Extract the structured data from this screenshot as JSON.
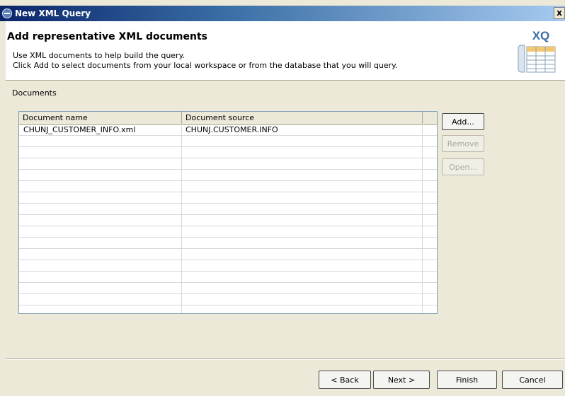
{
  "window": {
    "title": "New XML Query",
    "close_label": "x"
  },
  "header": {
    "title": "Add representative XML documents",
    "line1": "Use XML documents to help build the query.",
    "line2": "Click Add to select documents from your local workspace or from the database that you will query.",
    "badge": "XQ"
  },
  "section": {
    "label": "Documents"
  },
  "table": {
    "columns": [
      "Document name",
      "Document source"
    ],
    "rows": [
      [
        "CHUNJ_CUSTOMER_INFO.xml",
        "CHUNJ.CUSTOMER.INFO"
      ]
    ]
  },
  "side_buttons": {
    "add": "Add...",
    "remove": "Remove",
    "open": "Open..."
  },
  "footer": {
    "back": "< Back",
    "next": "Next >",
    "finish": "Finish",
    "cancel": "Cancel"
  },
  "colors": {
    "title_bar": "#0a246a",
    "badge": "#3a6ea5",
    "dialog_bg": "#ece9d8"
  }
}
